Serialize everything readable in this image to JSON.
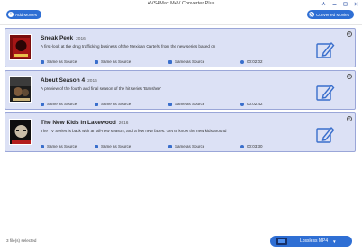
{
  "window": {
    "title": "AVS4Mac M4V Converter Plus",
    "controls": [
      "pin-icon",
      "minimize-icon",
      "maximize-icon",
      "close-icon"
    ]
  },
  "toolbar": {
    "add_movies_label": "Add Movies",
    "converted_movies_label": "Converted Movies"
  },
  "movies": [
    {
      "title": "Sneak Peek",
      "year": "2016",
      "description": "A first-look at the drug trafficking business of the Mexican Cartel's from the new series based on",
      "video": "Same as Source",
      "audio": "Same as Source",
      "subtitle": "Same as Source",
      "duration": "00:02:02"
    },
    {
      "title": "About Season 4",
      "year": "2016",
      "description": "A preview of the fourth and final season of the hit series 'Banshee'",
      "video": "Same as Source",
      "audio": "Same as Source",
      "subtitle": "Same as Source",
      "duration": "00:02:42"
    },
    {
      "title": "The New Kids in Lakewood",
      "year": "2016",
      "description": "The TV Series is back with an all-new season, and a few new faces. Get to know the new kids around",
      "video": "Same as Source",
      "audio": "Same as Source",
      "subtitle": "Same as Source",
      "duration": "00:03:30"
    }
  ],
  "footer": {
    "status": "3 file(s) selected",
    "output_format": "Lossless MP4"
  },
  "colors": {
    "accent": "#2f6fd4",
    "card_bg": "#dce1f5",
    "card_border": "#9aa6d8"
  }
}
